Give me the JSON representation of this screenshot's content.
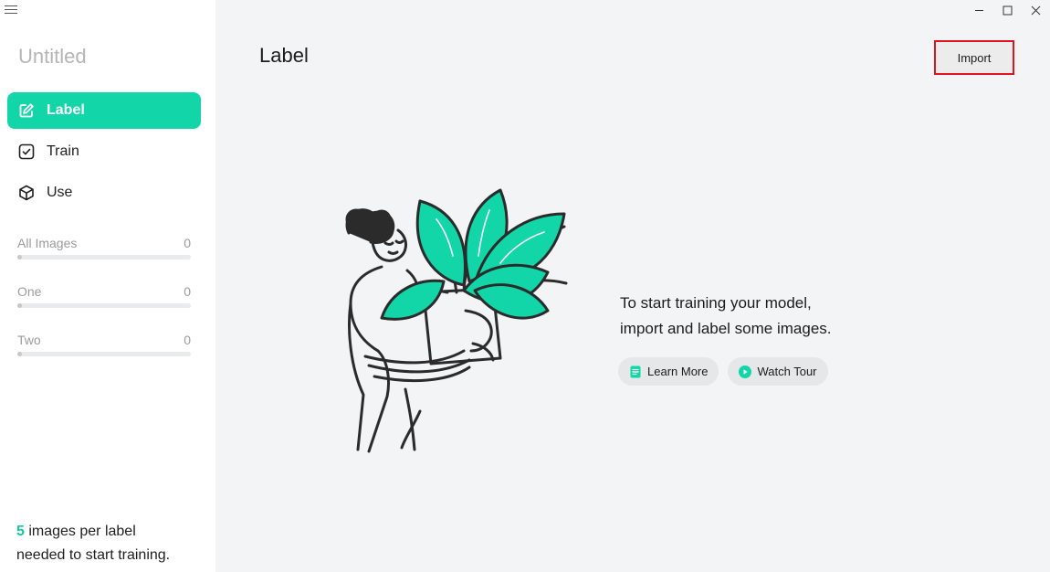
{
  "sidebar": {
    "project_title": "Untitled",
    "nav": [
      {
        "label": "Label",
        "icon": "edit-icon",
        "active": true
      },
      {
        "label": "Train",
        "icon": "checkbox-icon",
        "active": false
      },
      {
        "label": "Use",
        "icon": "cube-icon",
        "active": false
      }
    ],
    "classes": [
      {
        "name": "All Images",
        "count": "0"
      },
      {
        "name": "One",
        "count": "0"
      },
      {
        "name": "Two",
        "count": "0"
      }
    ],
    "footer": {
      "number": "5",
      "line1_rest": " images per label",
      "line2": "needed to start training."
    }
  },
  "main": {
    "title": "Label",
    "import_label": "Import",
    "empty_line1": "To start training your model,",
    "empty_line2": "import and label some images.",
    "learn_more_label": "Learn More",
    "watch_tour_label": "Watch Tour"
  },
  "colors": {
    "accent": "#12d6a8",
    "highlight_box": "#e0141e",
    "background": "#f3f4f6"
  }
}
